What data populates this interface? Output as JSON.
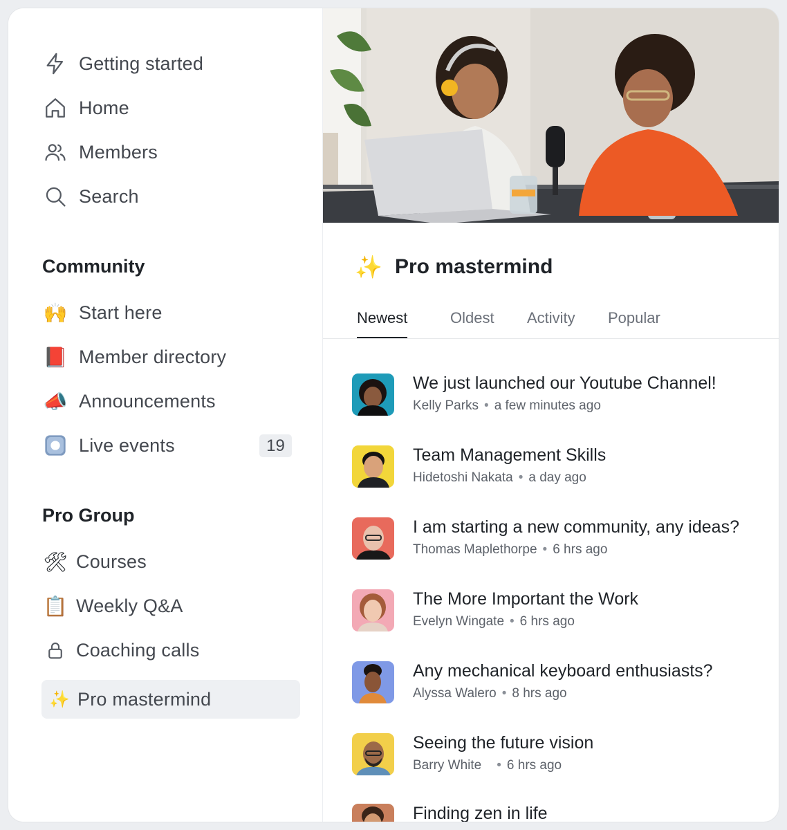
{
  "nav": {
    "items": [
      {
        "label": "Getting started",
        "icon": "lightning-icon"
      },
      {
        "label": "Home",
        "icon": "home-icon"
      },
      {
        "label": "Members",
        "icon": "members-icon"
      },
      {
        "label": "Search",
        "icon": "search-icon"
      }
    ]
  },
  "community": {
    "title": "Community",
    "items": [
      {
        "label": "Start here",
        "emoji": "🙌"
      },
      {
        "label": "Member directory",
        "emoji": "📕"
      },
      {
        "label": "Announcements",
        "emoji": "📣"
      },
      {
        "label": "Live events",
        "emoji": "⏺",
        "badge": "19"
      }
    ]
  },
  "pro_group": {
    "title": "Pro Group",
    "items": [
      {
        "label": "Courses",
        "emoji": "🛠"
      },
      {
        "label": "Weekly Q&A",
        "emoji": "📋"
      },
      {
        "label": "Coaching calls",
        "icon": "lock-icon"
      },
      {
        "label": "Pro mastermind",
        "emoji": "✨",
        "active": true
      }
    ]
  },
  "space": {
    "emoji": "✨",
    "title": "Pro mastermind",
    "tabs": [
      "Newest",
      "Oldest",
      "Activity",
      "Popular"
    ],
    "active_tab": "Newest"
  },
  "posts": [
    {
      "title": "We just launched our Youtube Channel!",
      "author": "Kelly Parks",
      "time": "a few minutes ago",
      "bg": "#1e9bb8"
    },
    {
      "title": "Team Management Skills",
      "author": "Hidetoshi Nakata",
      "time": "a day ago",
      "bg": "#f2d63a"
    },
    {
      "title": "I am starting a new community, any ideas?",
      "author": "Thomas Maplethorpe",
      "time": "6 hrs ago",
      "bg": "#e86a5c"
    },
    {
      "title": "The More Important the Work",
      "author": "Evelyn Wingate",
      "time": "6 hrs ago",
      "bg": "#f3a9b5"
    },
    {
      "title": "Any mechanical keyboard enthusiasts?",
      "author": "Alyssa Walero",
      "time": "8 hrs ago",
      "bg": "#7f99e6"
    },
    {
      "title": "Seeing the future vision",
      "author": "Barry White",
      "time": "6 hrs ago",
      "bg": "#f2cf4a"
    },
    {
      "title": "Finding zen in life",
      "author": "",
      "time": "",
      "bg": "#c97f5c"
    }
  ]
}
